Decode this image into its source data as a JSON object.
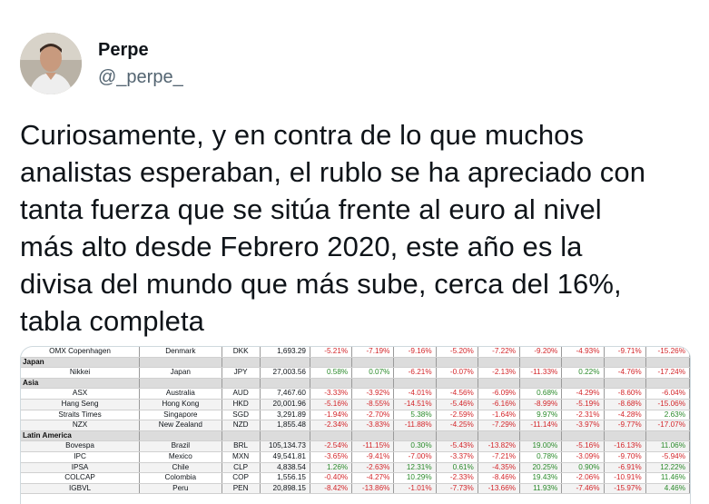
{
  "author": {
    "display_name": "Perpe",
    "handle": "@_perpe_"
  },
  "tweet": {
    "lines": [
      "Curiosamente, y en contra de lo que muchos",
      "analistas esperaban, el rublo se ha apreciado con",
      "tanta fuerza que se sitúa frente al euro al nivel",
      "más alto desde Febrero 2020, este año es la",
      "divisa del mundo que más sube, cerca del 16%,",
      "tabla completa"
    ]
  },
  "colors": {
    "negative": "#d3262a",
    "positive": "#2a8a2a",
    "region_bg": "#dcdcdc"
  },
  "table": {
    "rows": [
      {
        "kind": "row",
        "name": "OMX Copenhagen",
        "country": "Denmark",
        "ccy": "DKK",
        "level": "1,693.29",
        "v": [
          "-5.21%",
          "-7.19%",
          "-9.16%",
          "-5.20%",
          "-7.22%",
          "-9.20%",
          "-4.93%",
          "-9.71%",
          "-15.26%"
        ]
      },
      {
        "kind": "region",
        "name": "Japan"
      },
      {
        "kind": "row",
        "name": "Nikkei",
        "country": "Japan",
        "ccy": "JPY",
        "level": "27,003.56",
        "v": [
          "0.58%",
          "0.07%",
          "-6.21%",
          "-0.07%",
          "-2.13%",
          "-11.33%",
          "0.22%",
          "-4.76%",
          "-17.24%"
        ]
      },
      {
        "kind": "region",
        "name": "Asia"
      },
      {
        "kind": "row",
        "name": "ASX",
        "country": "Australia",
        "ccy": "AUD",
        "level": "7,467.60",
        "v": [
          "-3.33%",
          "-3.92%",
          "-4.01%",
          "-4.56%",
          "-6.09%",
          "0.68%",
          "-4.29%",
          "-8.60%",
          "-6.04%"
        ]
      },
      {
        "kind": "row",
        "name": "Hang Seng",
        "country": "Hong Kong",
        "ccy": "HKD",
        "level": "20,001.96",
        "v": [
          "-5.16%",
          "-8.55%",
          "-14.51%",
          "-5.46%",
          "-6.16%",
          "-8.99%",
          "-5.19%",
          "-8.68%",
          "-15.06%"
        ]
      },
      {
        "kind": "row",
        "name": "Straits Times",
        "country": "Singapore",
        "ccy": "SGD",
        "level": "3,291.89",
        "v": [
          "-1.94%",
          "-2.70%",
          "5.38%",
          "-2.59%",
          "-1.64%",
          "9.97%",
          "-2.31%",
          "-4.28%",
          "2.63%"
        ]
      },
      {
        "kind": "row",
        "name": "NZX",
        "country": "New Zealand",
        "ccy": "NZD",
        "level": "1,855.48",
        "v": [
          "-2.34%",
          "-3.83%",
          "-11.88%",
          "-4.25%",
          "-7.29%",
          "-11.14%",
          "-3.97%",
          "-9.77%",
          "-17.07%"
        ]
      },
      {
        "kind": "region",
        "name": "Latin America"
      },
      {
        "kind": "row",
        "name": "Bovespa",
        "country": "Brazil",
        "ccy": "BRL",
        "level": "105,134.73",
        "v": [
          "-2.54%",
          "-11.15%",
          "0.30%",
          "-5.43%",
          "-13.82%",
          "19.00%",
          "-5.16%",
          "-16.13%",
          "11.06%"
        ]
      },
      {
        "kind": "row",
        "name": "IPC",
        "country": "Mexico",
        "ccy": "MXN",
        "level": "49,541.81",
        "v": [
          "-3.65%",
          "-9.41%",
          "-7.00%",
          "-3.37%",
          "-7.21%",
          "0.78%",
          "-3.09%",
          "-9.70%",
          "-5.94%"
        ]
      },
      {
        "kind": "row",
        "name": "IPSA",
        "country": "Chile",
        "ccy": "CLP",
        "level": "4,838.54",
        "v": [
          "1.26%",
          "-2.63%",
          "12.31%",
          "0.61%",
          "-4.35%",
          "20.25%",
          "0.90%",
          "-6.91%",
          "12.22%"
        ]
      },
      {
        "kind": "row",
        "name": "COLCAP",
        "country": "Colombia",
        "ccy": "COP",
        "level": "1,556.15",
        "v": [
          "-0.40%",
          "-4.27%",
          "10.29%",
          "-2.33%",
          "-8.46%",
          "19.43%",
          "-2.06%",
          "-10.91%",
          "11.46%"
        ]
      },
      {
        "kind": "row",
        "name": "IGBVL",
        "country": "Peru",
        "ccy": "PEN",
        "level": "20,898.15",
        "v": [
          "-8.42%",
          "-13.86%",
          "-1.01%",
          "-7.73%",
          "-13.66%",
          "11.93%",
          "-7.46%",
          "-15.97%",
          "4.46%"
        ]
      }
    ]
  }
}
